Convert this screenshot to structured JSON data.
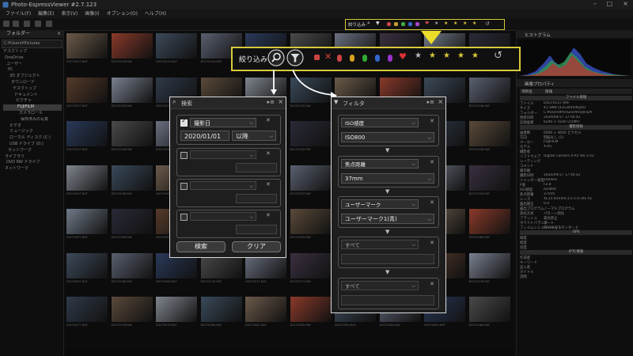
{
  "window": {
    "title": "Photo-EspressViewer  #2.7.123"
  },
  "menu": [
    "ファイル(F)",
    "編集(E)",
    "表示(V)",
    "画像(I)",
    "オプション(O)",
    "ヘルプ(H)"
  ],
  "left_panel": {
    "title": "フォルダー",
    "path": "C:¥Users¥Pictures",
    "tree": [
      "デスクトップ",
      "OneDrive",
      "ユーザー",
      "PC",
      "3D オブジェクト",
      "ダウンロード",
      "デスクトップ",
      "ドキュメント",
      "ピクチャ",
      "FUJIFILM",
      "カメラロール",
      "保存済みの写真",
      "ビデオ",
      "ミュージック",
      "ローカル ディスク (C:)",
      "USB ドライブ (D:)",
      "ネットワーク",
      "ライブラリ",
      "DVD RW ドライブ",
      "ネットワーク"
    ],
    "selected_index": 9
  },
  "grid": {
    "rows": [
      [
        "DSCF0017.RAF",
        "DSCF0018.RAF",
        "DSCF0019.RAF",
        "DSCF0020.RAF",
        "DSCF0021.RAF",
        "DSCF0022.RAF",
        "DSCF0023.RAF",
        "DSCF0024.RAF",
        "DSCF0025.RAF",
        "DSCF0026.RAF"
      ],
      [
        "DSCF0027.RAF",
        "DSCF0028.RAF",
        "DSCF0029.RAF",
        "DSCF0030.RAF",
        "DSCF0031.RAF",
        "DSCF0032.RAF",
        "DSCF0033.RAF",
        "DSCF0034.RAF",
        "DSCF0035.RAF",
        "DSCF0036.RAF"
      ],
      [
        "DSCF0037.RAF",
        "DSCF0038.RAF",
        "DSCF0039.RAF",
        "DSCF0040.RAF",
        "DSCF0041.RAF",
        "DSCF0042.RAF",
        "DSCF0043.RAF",
        "DSCF0044.RAF",
        "DSCF0045.RAF",
        "DSCF0046.RAF"
      ],
      [
        "DSCF0047.RAF",
        "DSCF0048.RAF",
        "DSCF0049.RAF",
        "DSCF0050.RAF",
        "DSCF0051.RAF",
        "DSCF0052.RAF",
        "DSCF0053.RAF",
        "DSCF0054.RAF",
        "DSCF0055.RAF",
        "DSCF0056.RAF"
      ],
      [
        "DSCF0057.RAF",
        "DSCF0058.RAF",
        "DSCF0059.RAF",
        "DSCF0060.RAF",
        "DSCF0061.RAF",
        "DSCF0062.RAF",
        "DSCF0063.RAF",
        "DSCF0064.RAF",
        "DSCF0065.RAF",
        "DSCF0066.RAF"
      ],
      [
        "DSCF0067.RAF",
        "DSCF0068.RAF",
        "DSCF0069.RAF",
        "DSCF0070.RAF",
        "DSCF0071.RAF",
        "DSCF0072.RAF",
        "DSCF0073.RAF",
        "DSCF0074.RAF",
        "DSCF0075.RAF",
        "DSCF0076.RAF"
      ],
      [
        "DSCF0077.RAF",
        "DSCF0078.RAF",
        "DSCF0079.RAF",
        "DSCF0080.RAF",
        "DSCF0081.RAF",
        "DSCF0082.RAF",
        "DSCF0083.RAF",
        "DSCF0084.RAF",
        "DSCF0085.RAF",
        "DSCF0086.RAF"
      ]
    ],
    "colors": [
      "#6b5a4a",
      "#8a3a2a",
      "#3d4a5a",
      "#5a6070",
      "#2a3a5a",
      "#4a4a4a",
      "#6a7080",
      "#3a3040",
      "#707a88",
      "#2a2a38",
      "#553a2a",
      "#7a8090",
      "#303a4a",
      "#5a4a3a",
      "#80858e",
      "#3a4a5a"
    ]
  },
  "top_strip": {
    "label": "絞り込み"
  },
  "callout": {
    "label": "絞り込み"
  },
  "search_dialog": {
    "title": "検索",
    "condition1": {
      "label": "撮影日",
      "date": "2020/01/01",
      "op": "以降"
    },
    "search_btn": "検索",
    "clear_btn": "クリア"
  },
  "filter_dialog": {
    "title": "フィルタ",
    "groups": [
      {
        "key": "ISO感度",
        "value": "ISO800"
      },
      {
        "key": "焦点距離",
        "value": "37mm"
      },
      {
        "key": "ユーザーマーク",
        "value": "ユーザーマーク1(青)"
      },
      {
        "key": "すべて",
        "value": ""
      },
      {
        "key": "すべて",
        "value": ""
      }
    ]
  },
  "right_panel": {
    "histogram_title": "ヒストグラム",
    "info_title": "画像プロパティ",
    "header_key": "項目名",
    "header_val": "情報",
    "sec_file": "ファイル情報",
    "file_rows": [
      [
        "ファイル",
        "DSCF0137.RAF"
      ],
      [
        "サイズ",
        "41.5MB (43534000byte)"
      ],
      [
        "フォルダー",
        "C:¥Users¥Pictures¥FUJIFILM"
      ],
      [
        "更新日時",
        "2020/09/17 17:56:42"
      ],
      [
        "記録画素",
        "6240 × 4160 (25MP)"
      ]
    ],
    "sec_image": "撮影情報",
    "image_rows": [
      [
        "画素数",
        "6000 × 4000 ピクセル"
      ],
      [
        "方向",
        "回転なし (1)"
      ],
      [
        "メーカー",
        "FUJIFILM"
      ],
      [
        "モデル",
        "X-A5"
      ],
      [
        "撮影者",
        ""
      ],
      [
        "ソフトウェア",
        "Digital Camera X-A5 Ver.3.02"
      ],
      [
        "レーティング",
        ""
      ],
      [
        "コメント",
        ""
      ],
      [
        "著作権",
        ""
      ],
      [
        "撮影日時",
        "2020/09/17 17:56:42"
      ],
      [
        "シャッター速度",
        "1/60sec"
      ],
      [
        "F値",
        "F2.8"
      ],
      [
        "ISO感度",
        "ISO800"
      ],
      [
        "焦点距離",
        "37mm"
      ],
      [
        "レンズ",
        "XC15-45mmF3.5-5.6 OIS PZ"
      ],
      [
        "露出補正",
        "0.0"
      ],
      [
        "露出プログラム",
        "ノーマルプログラム"
      ],
      [
        "測光方式",
        "パターン測光"
      ],
      [
        "フラッシュ",
        "発光禁止"
      ],
      [
        "ホワイトバランス",
        "オート"
      ],
      [
        "フィルムシミュレーション",
        "PROVIA/スタンダード"
      ]
    ],
    "sec_gps": "GPS",
    "gps_rows": [
      [
        "緯度",
        ""
      ],
      [
        "経度",
        ""
      ],
      [
        "高度",
        ""
      ]
    ],
    "sec_iptc": "IPTC情報",
    "iptc_rows": [
      [
        "作成者",
        ""
      ],
      [
        "キーワード",
        ""
      ],
      [
        "記入者",
        ""
      ],
      [
        "タイトル",
        ""
      ],
      [
        "説明",
        ""
      ]
    ]
  }
}
